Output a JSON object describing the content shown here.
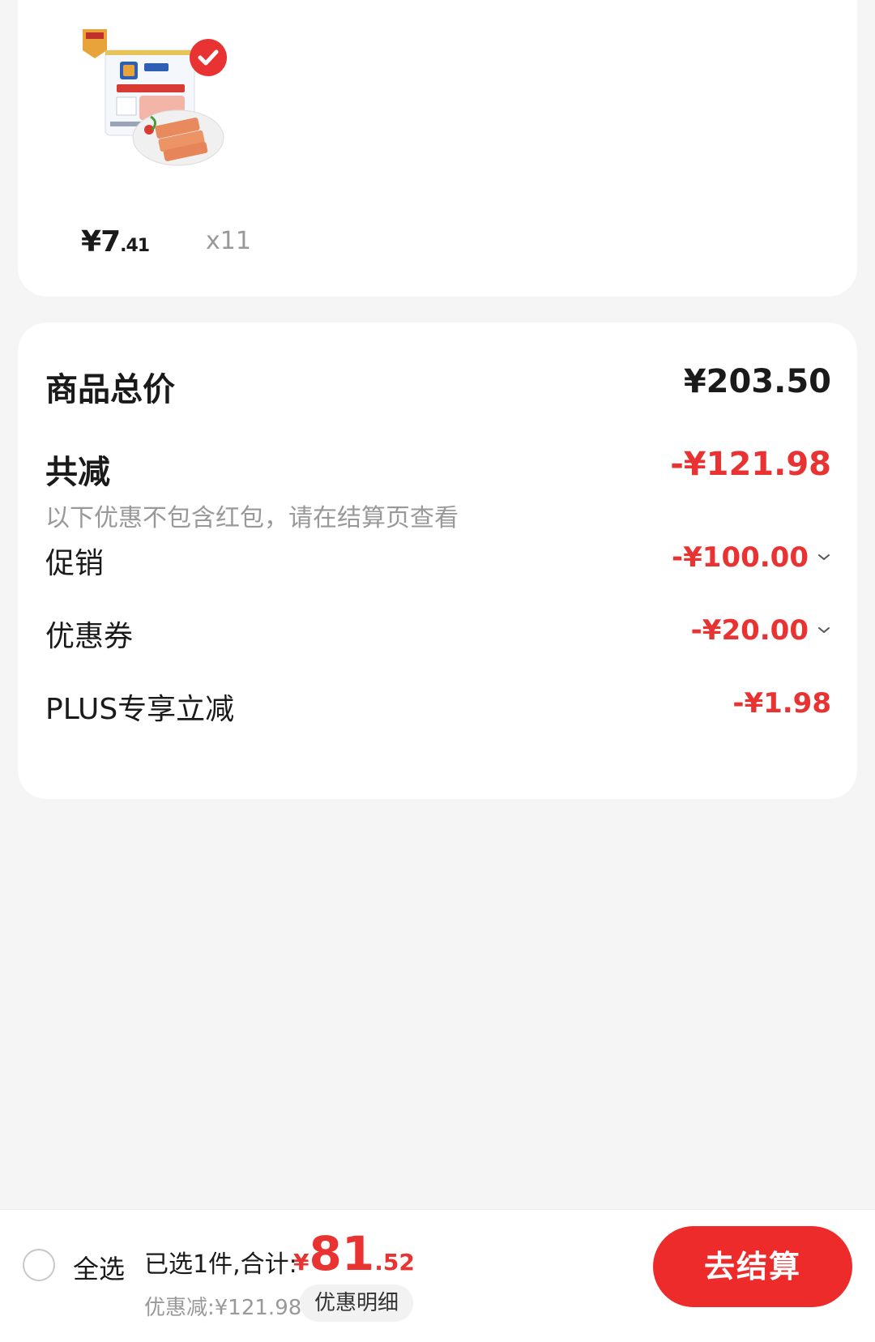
{
  "product": {
    "image_name": "luncheon-meat-can",
    "checked": true,
    "price_currency": "¥",
    "price_int": "7",
    "price_dec": ".41",
    "quantity": "x11"
  },
  "summary": {
    "total_label": "商品总价",
    "total_value": "¥203.50",
    "reduce_label": "共减",
    "reduce_value": "-¥121.98",
    "note": "以下优惠不包含红包，请在结算页查看",
    "items": [
      {
        "label": "促销",
        "value": "-¥100.00",
        "expandable": true
      },
      {
        "label": "优惠券",
        "value": "-¥20.00",
        "expandable": true
      },
      {
        "label": "PLUS专享立减",
        "value": "-¥1.98",
        "expandable": false
      }
    ]
  },
  "bottom_bar": {
    "select_all_label": "全选",
    "selected_text": "已选1件,合计:",
    "total_currency": "¥",
    "total_int": "81",
    "total_dec": ".52",
    "discount_text": "优惠减:¥121.98",
    "detail_label": "优惠明细",
    "checkout_label": "去结算"
  },
  "colors": {
    "accent_red": "#e93232",
    "checkout_red": "#ee2b2b",
    "background": "#f5f5f5",
    "muted_text": "#999999"
  }
}
